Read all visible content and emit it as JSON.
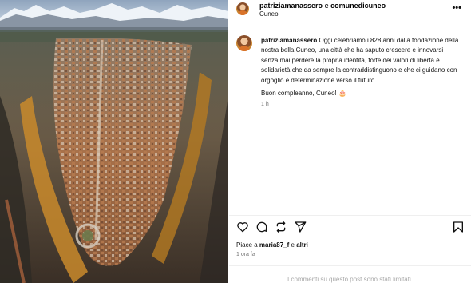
{
  "post": {
    "header": {
      "author": "patriziamanassero",
      "conjunction": "e",
      "coauthor": "comunedicuneo",
      "location": "Cuneo",
      "more_icon": "more-horizontal-icon"
    },
    "caption": {
      "author": "patriziamanassero",
      "text": "Oggi celebriamo i 828 anni dalla fondazione della nostra bella Cuneo, una città che ha saputo crescere e innovarsi senza mai perdere la propria identità, forte dei valori di libertà e solidarietà che da sempre la contraddistinguono e che ci guidano con orgoglio e determinazione verso il futuro.",
      "closing": "Buon compleanno, Cuneo! 🎂",
      "time": "1 h"
    },
    "actions": {
      "like_icon": "heart-icon",
      "comment_icon": "comment-icon",
      "share_icon": "repost-icon",
      "send_icon": "send-icon",
      "save_icon": "bookmark-icon"
    },
    "likes": {
      "prefix": "Piace a",
      "user": "maria87_f",
      "joiner": "e",
      "others": "altri"
    },
    "time": "1 ora fa",
    "comments_status": "I commenti su questo post sono stati limitati."
  },
  "photo": {
    "subject": "aerial view of Cuneo with snowy Alps",
    "colors": {
      "sky": "#c9d6e3",
      "mountains": "#eef3f8",
      "city": "#a06a45",
      "trees": "#c98a2c"
    }
  }
}
